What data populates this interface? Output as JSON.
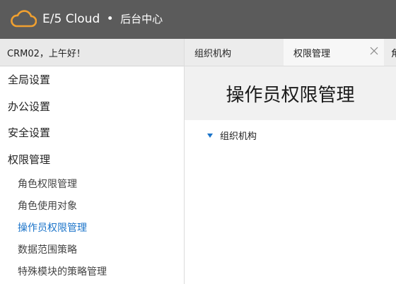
{
  "header": {
    "brand": "E/5 Cloud",
    "separator": "•",
    "section": "后台中心"
  },
  "sidebar": {
    "greeting": "CRM02，上午好！",
    "groups": [
      {
        "label": "全局设置"
      },
      {
        "label": "办公设置"
      },
      {
        "label": "安全设置"
      },
      {
        "label": "权限管理"
      }
    ],
    "items": [
      {
        "label": "角色权限管理"
      },
      {
        "label": "角色使用对象"
      },
      {
        "label": "操作员权限管理",
        "active": true
      },
      {
        "label": "数据范围策略"
      },
      {
        "label": "特殊模块的策略管理"
      }
    ]
  },
  "tabs": [
    {
      "label": "组织机构"
    },
    {
      "label": "权限管理",
      "active": true
    },
    {
      "label": "角"
    }
  ],
  "main": {
    "title": "操作员权限管理",
    "tree_node": "组织机构"
  },
  "colors": {
    "topbar": "#5b5b5b",
    "logo": "#f0a030",
    "active_link": "#1a73c9",
    "caret": "#1a73c9"
  },
  "icons": {
    "logo": "cloud-icon",
    "tab_close": "close-icon",
    "tree_toggle": "caret-down-icon"
  }
}
